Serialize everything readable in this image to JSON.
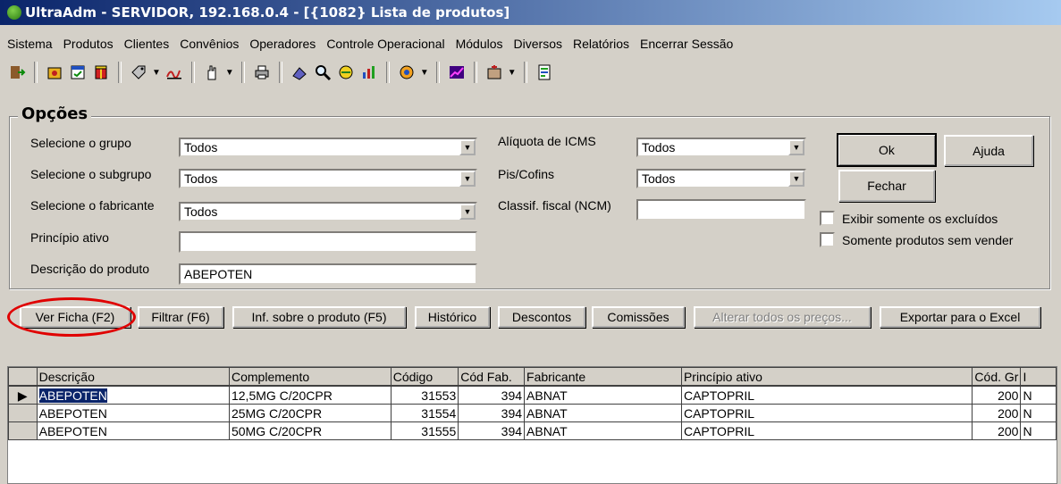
{
  "window": {
    "title": "UltraAdm - SERVIDOR, 192.168.0.4 - [{1082} Lista de produtos]"
  },
  "menu": [
    "Sistema",
    "Produtos",
    "Clientes",
    "Convênios",
    "Operadores",
    "Controle Operacional",
    "Módulos",
    "Diversos",
    "Relatórios",
    "Encerrar Sessão"
  ],
  "toolbar_icons": [
    "exit-icon",
    "package-icon",
    "calendar-icon",
    "gift-icon",
    "tag-icon",
    "signature-icon",
    "hand-icon",
    "printer-icon",
    "book-icon",
    "magnifier-icon",
    "pill-icon",
    "chart-icon",
    "medicine-icon",
    "trend-chart-icon",
    "pharmacy-icon",
    "report-icon"
  ],
  "options": {
    "title": "Opções",
    "group_label": "Selecione o grupo",
    "group_value": "Todos",
    "subgroup_label": "Selecione o subgrupo",
    "subgroup_value": "Todos",
    "manufacturer_label": "Selecione o fabricante",
    "manufacturer_value": "Todos",
    "active_label": "Princípio ativo",
    "active_value": "",
    "description_label": "Descrição do produto",
    "description_value": "ABEPOTEN",
    "icms_label": "Alíquota de ICMS",
    "icms_value": "Todos",
    "pis_label": "Pis/Cofins",
    "pis_value": "Todos",
    "ncm_label": "Classif. fiscal (NCM)",
    "ncm_value": "",
    "ok": "Ok",
    "help": "Ajuda",
    "close": "Fechar",
    "excluded_only": "Exibir somente os excluídos",
    "not_sold": "Somente produtos sem vender"
  },
  "actions": {
    "ficha": "Ver Ficha (F2)",
    "filter": "Filtrar (F6)",
    "info": "Inf. sobre o produto (F5)",
    "history": "Histórico",
    "discounts": "Descontos",
    "commissions": "Comissões",
    "change_prices": "Alterar todos os preços...",
    "export": "Exportar para o Excel"
  },
  "grid": {
    "columns": [
      "Descrição",
      "Complemento",
      "Código",
      "Cód Fab.",
      "Fabricante",
      "Princípio ativo",
      "Cód. Gr",
      "I"
    ],
    "rows": [
      [
        "ABEPOTEN",
        "12,5MG C/20CPR",
        "31553",
        "394",
        "ABNAT",
        "CAPTOPRIL",
        "200",
        "N"
      ],
      [
        "ABEPOTEN",
        "25MG C/20CPR",
        "31554",
        "394",
        "ABNAT",
        "CAPTOPRIL",
        "200",
        "N"
      ],
      [
        "ABEPOTEN",
        "50MG C/20CPR",
        "31555",
        "394",
        "ABNAT",
        "CAPTOPRIL",
        "200",
        "N"
      ]
    ]
  }
}
